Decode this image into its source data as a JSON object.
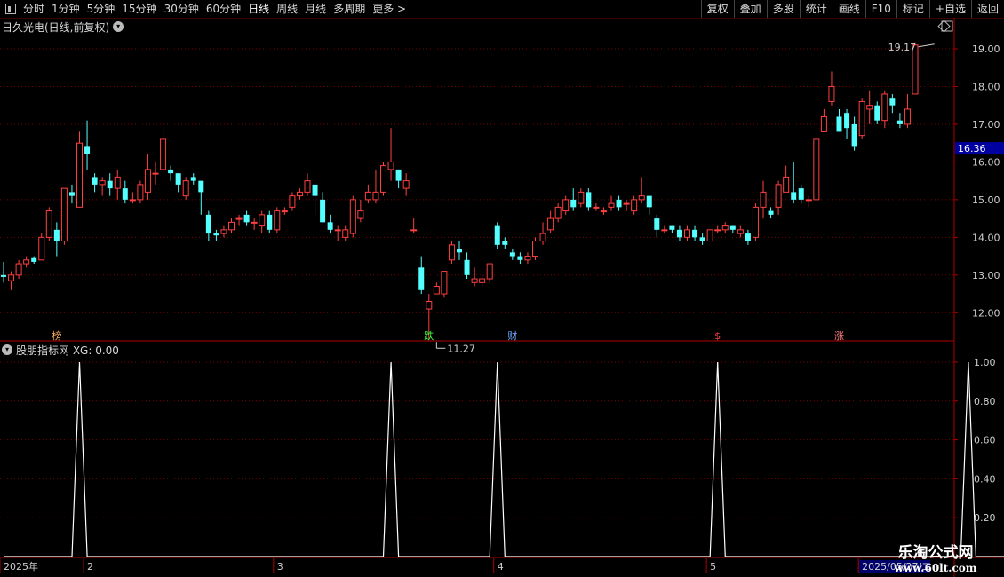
{
  "toolbar": {
    "left": [
      "分时",
      "1分钟",
      "5分钟",
      "15分钟",
      "30分钟",
      "60分钟",
      "日线",
      "周线",
      "月线",
      "多周期",
      "更多 >"
    ],
    "active": "日线",
    "right": [
      "复权",
      "叠加",
      "多股",
      "统计",
      "画线",
      "F10",
      "标记",
      "+自选",
      "返回"
    ]
  },
  "main_panel": {
    "title": "日久光电(日线,前复权)"
  },
  "sub_panel": {
    "title": "股朋指标网 XG: 0.00"
  },
  "colors": {
    "up": "#ff4040",
    "down": "#54ffff",
    "grid": "#7a0000",
    "axis": "#b00000",
    "line": "#ffffff",
    "price_tag_bg": "#0000a0"
  },
  "chart_data": [
    {
      "type": "candlestick",
      "title": "日久光电(日线,前复权)",
      "ylim": [
        11.3,
        19.4
      ],
      "yticks": [
        12.0,
        13.0,
        14.0,
        15.0,
        16.0,
        17.0,
        18.0,
        19.0
      ],
      "current_price": "16.36",
      "annotations": [
        {
          "text": "19.17",
          "index": 123,
          "value": 19.17
        },
        {
          "text": "11.27",
          "index": 57,
          "value": 11.27
        }
      ],
      "event_markers": [
        {
          "text": "榜",
          "index": 7,
          "color": "#ffb060"
        },
        {
          "text": "跌",
          "index": 56,
          "color": "#40ff40"
        },
        {
          "text": "财",
          "index": 67,
          "color": "#6fa8ff"
        },
        {
          "text": "$",
          "index": 94,
          "color": "#ff4040"
        },
        {
          "text": "涨",
          "index": 110,
          "color": "#ff8080"
        }
      ],
      "ohlc": [
        [
          13.0,
          12.95,
          13.35,
          12.8
        ],
        [
          12.85,
          13.0,
          13.1,
          12.6
        ],
        [
          13.0,
          13.3,
          13.4,
          12.9
        ],
        [
          13.3,
          13.4,
          13.5,
          13.2
        ],
        [
          13.45,
          13.35,
          13.5,
          13.3
        ],
        [
          13.4,
          14.0,
          14.1,
          13.4
        ],
        [
          14.0,
          14.7,
          14.8,
          13.9
        ],
        [
          14.2,
          13.9,
          14.4,
          13.5
        ],
        [
          13.9,
          15.3,
          15.3,
          13.8
        ],
        [
          15.2,
          15.1,
          15.4,
          14.9
        ],
        [
          14.8,
          16.5,
          16.8,
          14.8
        ],
        [
          16.4,
          16.2,
          17.1,
          15.8
        ],
        [
          15.6,
          15.4,
          15.7,
          15.2
        ],
        [
          15.4,
          15.5,
          15.6,
          15.1
        ],
        [
          15.5,
          15.3,
          15.7,
          15.1
        ],
        [
          15.3,
          15.6,
          15.8,
          15.0
        ],
        [
          15.3,
          15.0,
          15.5,
          14.9
        ],
        [
          15.0,
          15.0,
          15.2,
          14.9
        ],
        [
          15.0,
          15.4,
          15.5,
          14.9
        ],
        [
          15.2,
          15.8,
          16.2,
          15.0
        ],
        [
          15.7,
          15.7,
          16.0,
          15.4
        ],
        [
          15.8,
          16.6,
          16.9,
          15.7
        ],
        [
          15.8,
          15.7,
          15.9,
          15.5
        ],
        [
          15.7,
          15.4,
          15.6,
          15.2
        ],
        [
          15.1,
          15.5,
          15.6,
          15.0
        ],
        [
          15.6,
          15.5,
          15.7,
          15.4
        ],
        [
          15.5,
          15.2,
          15.3,
          14.6
        ],
        [
          14.6,
          14.1,
          14.7,
          13.9
        ],
        [
          14.1,
          14.05,
          14.2,
          13.9
        ],
        [
          14.1,
          14.2,
          14.3,
          14.0
        ],
        [
          14.2,
          14.4,
          14.5,
          14.1
        ],
        [
          14.5,
          14.5,
          14.6,
          14.3
        ],
        [
          14.6,
          14.4,
          14.7,
          14.3
        ],
        [
          14.4,
          14.4,
          14.5,
          14.2
        ],
        [
          14.3,
          14.6,
          14.7,
          14.1
        ],
        [
          14.6,
          14.2,
          14.7,
          14.1
        ],
        [
          14.2,
          14.7,
          14.8,
          14.1
        ],
        [
          14.7,
          14.7,
          14.8,
          14.6
        ],
        [
          14.8,
          15.1,
          15.2,
          14.7
        ],
        [
          15.1,
          15.2,
          15.3,
          15.0
        ],
        [
          15.2,
          15.5,
          15.7,
          15.1
        ],
        [
          15.4,
          15.1,
          15.3,
          14.6
        ],
        [
          15.0,
          14.4,
          15.2,
          14.4
        ],
        [
          14.4,
          14.2,
          14.6,
          14.1
        ],
        [
          14.2,
          14.2,
          14.3,
          13.9
        ],
        [
          14.0,
          14.2,
          14.3,
          13.9
        ],
        [
          14.1,
          15.0,
          15.1,
          14.0
        ],
        [
          14.5,
          14.7,
          15.0,
          14.4
        ],
        [
          15.0,
          15.2,
          15.4,
          14.9
        ],
        [
          15.0,
          15.2,
          15.8,
          14.9
        ],
        [
          15.2,
          15.9,
          16.0,
          15.1
        ],
        [
          15.8,
          16.0,
          16.9,
          15.5
        ],
        [
          15.8,
          15.5,
          15.8,
          15.3
        ],
        [
          15.3,
          15.5,
          15.7,
          15.1
        ],
        [
          14.2,
          14.2,
          14.5,
          14.1
        ],
        [
          13.2,
          12.6,
          13.5,
          12.5
        ],
        [
          12.1,
          12.3,
          12.5,
          11.27
        ],
        [
          12.5,
          12.7,
          12.8,
          12.5
        ],
        [
          12.5,
          13.1,
          13.1,
          12.4
        ],
        [
          13.4,
          13.8,
          13.9,
          13.3
        ],
        [
          13.7,
          13.6,
          13.9,
          13.4
        ],
        [
          13.4,
          13.0,
          13.6,
          12.9
        ],
        [
          12.8,
          12.9,
          13.2,
          12.7
        ],
        [
          12.8,
          12.9,
          13.0,
          12.7
        ],
        [
          12.9,
          13.3,
          13.3,
          12.8
        ],
        [
          14.3,
          13.8,
          14.4,
          13.7
        ],
        [
          13.9,
          13.8,
          14.0,
          13.7
        ],
        [
          13.6,
          13.5,
          13.7,
          13.4
        ],
        [
          13.5,
          13.4,
          13.6,
          13.3
        ],
        [
          13.4,
          13.5,
          13.6,
          13.3
        ],
        [
          13.5,
          13.9,
          14.0,
          13.4
        ],
        [
          13.9,
          14.1,
          14.4,
          13.8
        ],
        [
          14.2,
          14.5,
          14.7,
          14.1
        ],
        [
          14.5,
          14.8,
          14.9,
          14.4
        ],
        [
          14.7,
          15.0,
          15.1,
          14.6
        ],
        [
          15.0,
          14.8,
          15.3,
          14.7
        ],
        [
          14.9,
          15.2,
          15.3,
          14.8
        ],
        [
          15.2,
          14.8,
          15.3,
          14.7
        ],
        [
          14.8,
          14.8,
          14.9,
          14.7
        ],
        [
          14.7,
          14.7,
          14.8,
          14.6
        ],
        [
          14.8,
          14.9,
          15.1,
          14.7
        ],
        [
          15.0,
          14.8,
          15.1,
          14.7
        ],
        [
          14.9,
          14.9,
          15.0,
          14.7
        ],
        [
          14.7,
          15.0,
          15.1,
          14.6
        ],
        [
          15.0,
          15.1,
          15.6,
          14.9
        ],
        [
          15.1,
          14.8,
          15.1,
          14.6
        ],
        [
          14.5,
          14.2,
          14.6,
          14.0
        ],
        [
          14.2,
          14.2,
          14.3,
          14.1
        ],
        [
          14.3,
          14.2,
          14.3,
          14.1
        ],
        [
          14.2,
          14.0,
          14.3,
          13.9
        ],
        [
          14.0,
          14.2,
          14.3,
          13.9
        ],
        [
          14.2,
          14.0,
          14.3,
          13.9
        ],
        [
          14.0,
          13.9,
          14.1,
          13.8
        ],
        [
          13.9,
          14.2,
          14.2,
          13.9
        ],
        [
          14.2,
          14.2,
          14.3,
          14.1
        ],
        [
          14.2,
          14.3,
          14.4,
          14.1
        ],
        [
          14.3,
          14.2,
          14.3,
          14.1
        ],
        [
          14.1,
          14.2,
          14.3,
          14.0
        ],
        [
          14.1,
          13.9,
          14.2,
          13.8
        ],
        [
          14.0,
          14.8,
          14.9,
          13.9
        ],
        [
          14.8,
          15.2,
          15.5,
          14.5
        ],
        [
          14.7,
          14.6,
          14.8,
          14.5
        ],
        [
          14.8,
          15.4,
          15.5,
          14.6
        ],
        [
          15.2,
          15.6,
          15.9,
          15.2
        ],
        [
          15.2,
          15.0,
          16.0,
          14.9
        ],
        [
          15.3,
          15.0,
          15.4,
          14.9
        ],
        [
          15.0,
          15.0,
          15.1,
          14.8
        ],
        [
          15.0,
          16.6,
          16.6,
          15.0
        ],
        [
          16.8,
          17.2,
          17.4,
          16.8
        ],
        [
          17.6,
          18.0,
          18.4,
          17.5
        ],
        [
          17.2,
          16.8,
          17.4,
          16.8
        ],
        [
          17.3,
          16.9,
          17.4,
          16.6
        ],
        [
          17.0,
          16.4,
          17.2,
          16.3
        ],
        [
          16.7,
          17.6,
          17.7,
          16.6
        ],
        [
          17.4,
          17.5,
          17.9,
          17.0
        ],
        [
          17.5,
          17.1,
          17.6,
          17.0
        ],
        [
          17.1,
          17.8,
          17.9,
          16.9
        ],
        [
          17.7,
          17.5,
          17.8,
          17.3
        ],
        [
          17.1,
          17.0,
          17.3,
          16.9
        ],
        [
          17.0,
          17.4,
          17.8,
          16.9
        ],
        [
          17.8,
          19.1,
          19.17,
          17.8
        ]
      ]
    },
    {
      "type": "line",
      "title": "股朋指标网 XG: 0.00",
      "series": [
        {
          "name": "XG",
          "spikes": [
            10,
            51,
            65,
            94,
            127
          ]
        }
      ],
      "ylim": [
        0,
        1.05
      ],
      "yticks": [
        0.2,
        0.4,
        0.6,
        0.8,
        1.0
      ],
      "x_labels": [
        {
          "text": "2025年",
          "index": 0
        },
        {
          "text": "2",
          "index": 11
        },
        {
          "text": "3",
          "index": 36
        },
        {
          "text": "4",
          "index": 65
        },
        {
          "text": "5",
          "index": 93
        },
        {
          "text": "2025/05/27/二",
          "index": 113
        }
      ]
    }
  ],
  "watermark": {
    "line1": "乐淘公式网",
    "line2": "www.60lt.com"
  }
}
